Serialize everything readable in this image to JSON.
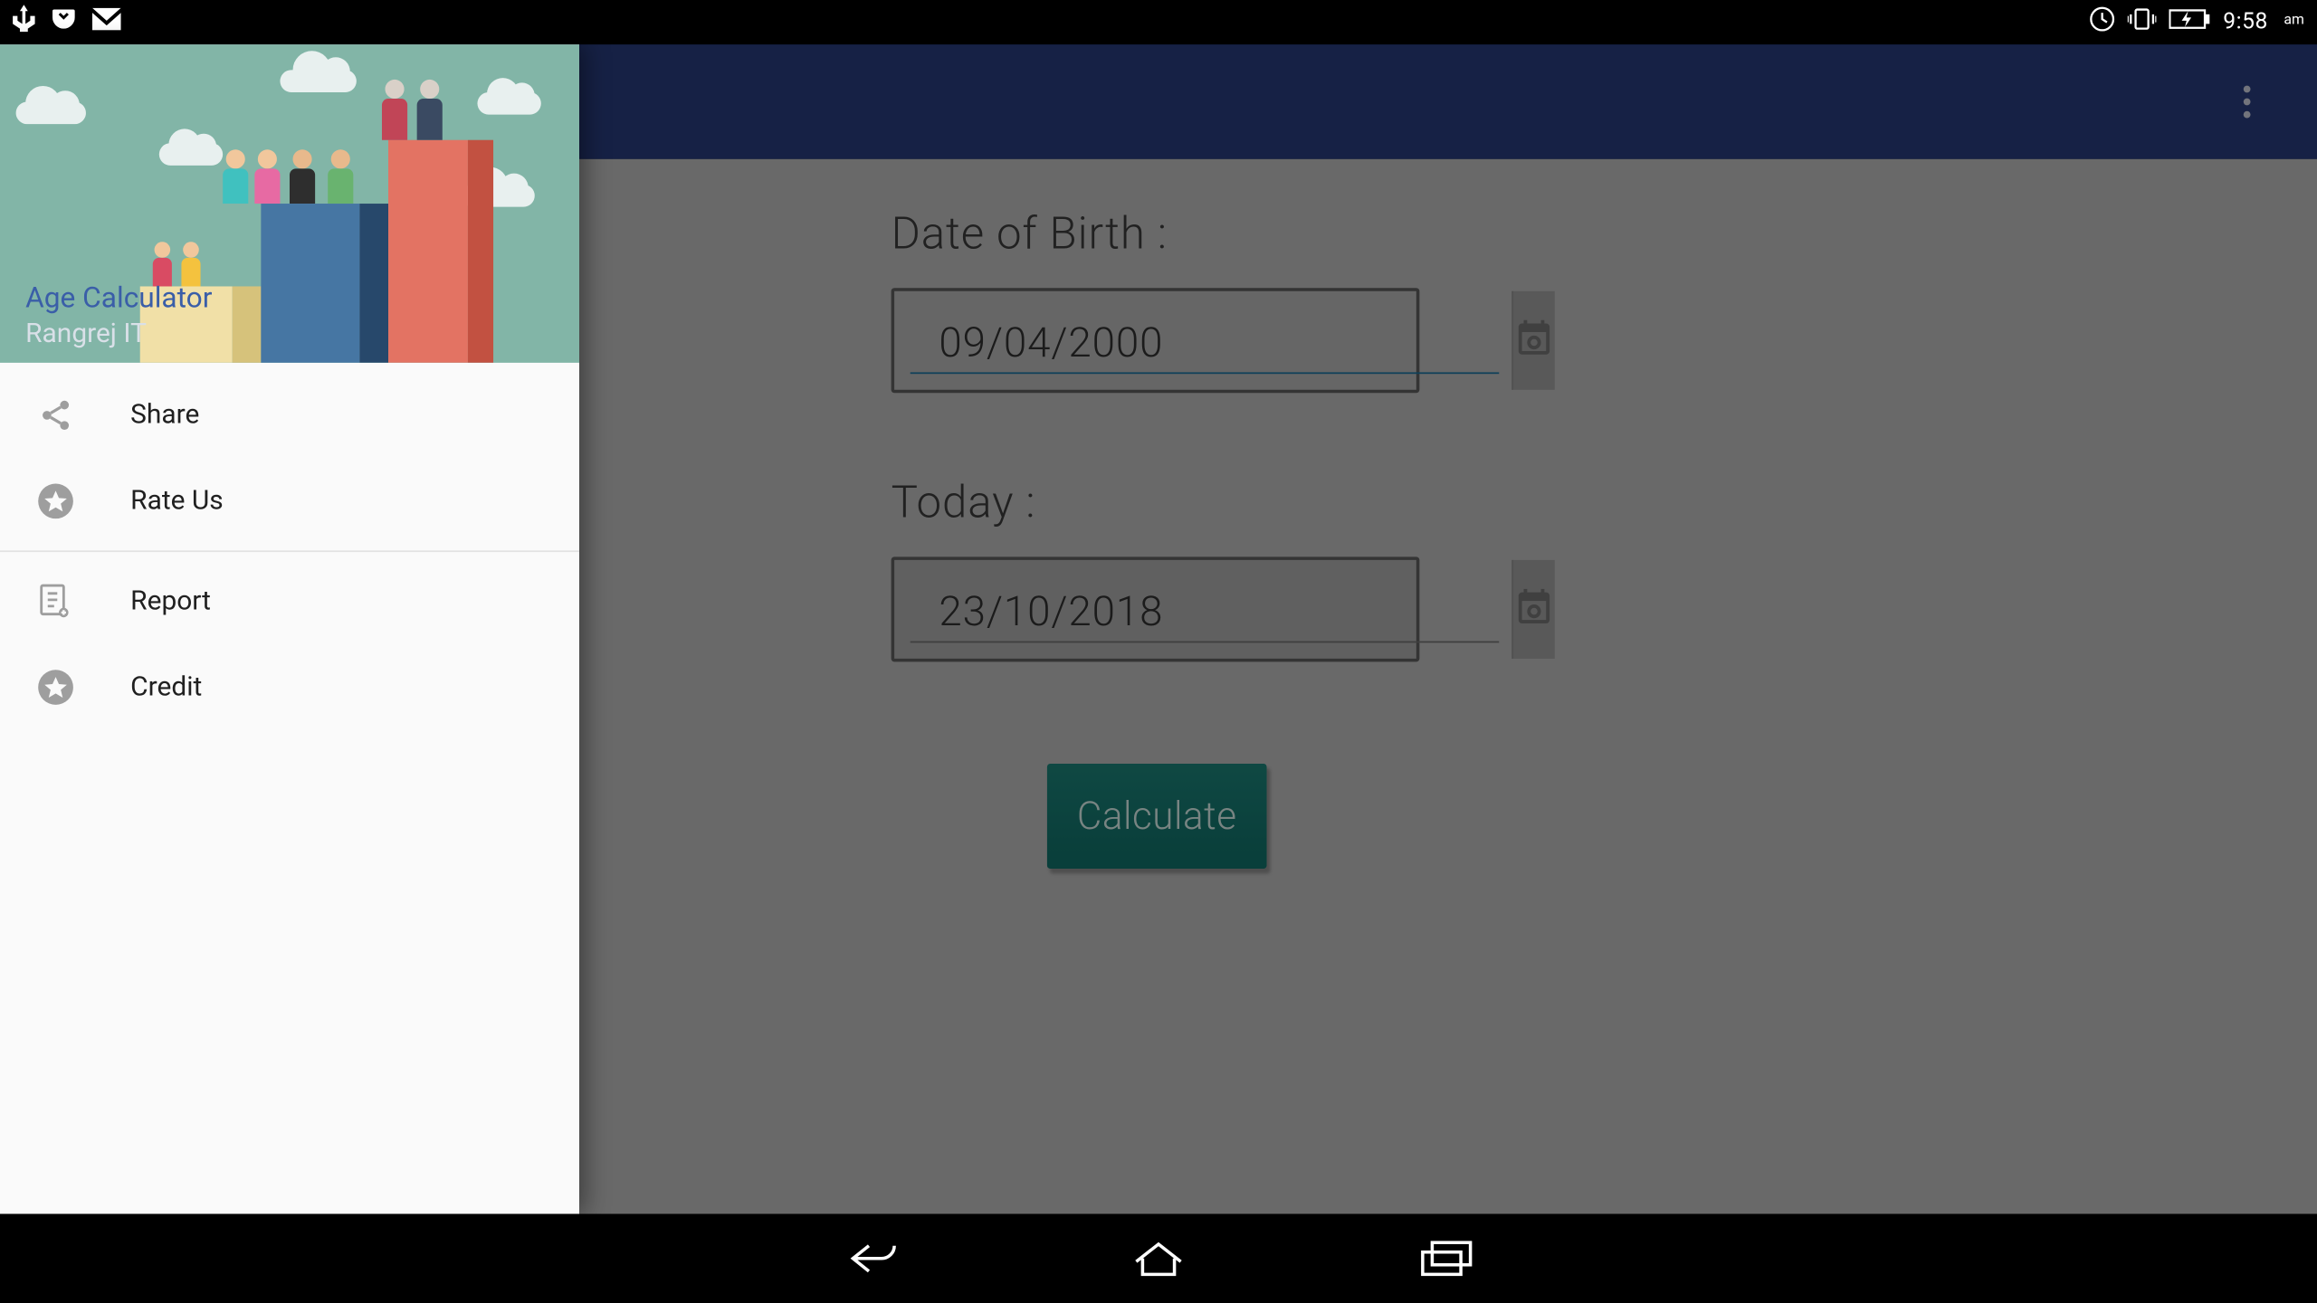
{
  "statusbar": {
    "time": "9:58",
    "ampm": "am"
  },
  "drawer": {
    "title": "Age Calculator",
    "subtitle": "Rangrej IT",
    "items": [
      {
        "icon": "share-icon",
        "label": "Share"
      },
      {
        "icon": "star-icon",
        "label": "Rate Us"
      },
      {
        "sep": true
      },
      {
        "icon": "report-icon",
        "label": "Report"
      },
      {
        "icon": "star-icon",
        "label": "Credit"
      }
    ]
  },
  "main": {
    "dob_label": "Date of Birth :",
    "dob_value": "09/04/2000",
    "today_label": "Today :",
    "today_value": "23/10/2018",
    "calculate_label": "Calculate"
  }
}
